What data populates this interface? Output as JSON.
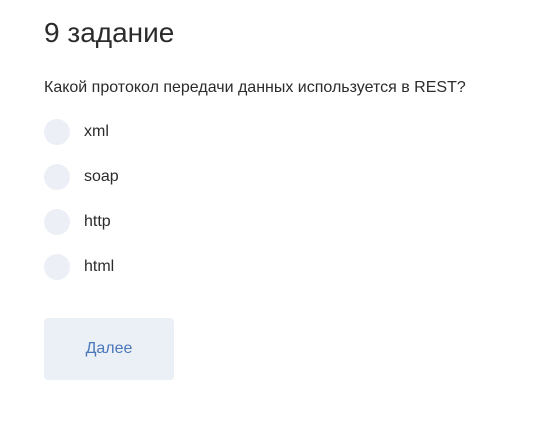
{
  "quiz": {
    "title": "9 задание",
    "question": "Какой протокол передачи данных используется в REST?",
    "options": [
      {
        "label": "xml"
      },
      {
        "label": "soap"
      },
      {
        "label": "http"
      },
      {
        "label": "html"
      }
    ],
    "next_label": "Далее"
  },
  "colors": {
    "text": "#2b2b2b",
    "radio_fill": "#eceff5",
    "button_bg": "#ebeff6",
    "button_text": "#4a78bb"
  }
}
